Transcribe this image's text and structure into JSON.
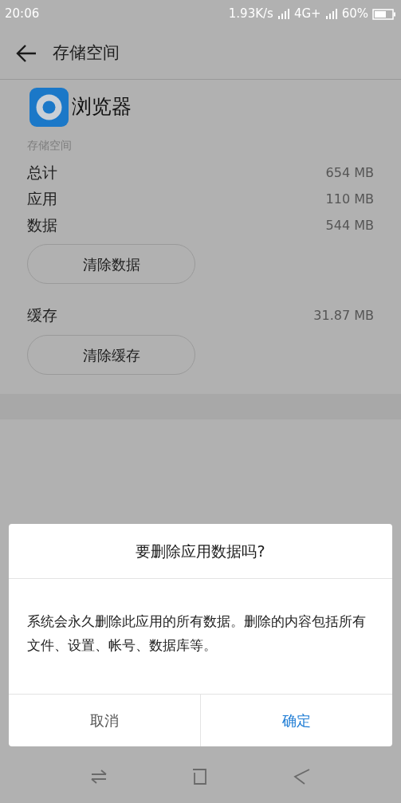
{
  "status_bar": {
    "time": "20:06",
    "speed": "1.93K/s",
    "network": "4G+",
    "battery": "60%"
  },
  "header": {
    "title": "存储空间"
  },
  "app": {
    "name": "浏览器"
  },
  "section": {
    "label": "存储空间"
  },
  "rows": [
    {
      "label": "总计",
      "value": "654 MB"
    },
    {
      "label": "应用",
      "value": "110 MB"
    },
    {
      "label": "数据",
      "value": "544 MB"
    }
  ],
  "clear_data_button": "清除数据",
  "cache": {
    "label": "缓存",
    "value": "31.87 MB"
  },
  "clear_cache_button": "清除缓存",
  "dialog": {
    "title": "要删除应用数据吗?",
    "message": "系统会永久删除此应用的所有数据。删除的内容包括所有文件、设置、帐号、数据库等。",
    "buttons": [
      {
        "label": "取消",
        "kind": "cancel"
      },
      {
        "label": "确定",
        "kind": "confirm"
      }
    ]
  }
}
